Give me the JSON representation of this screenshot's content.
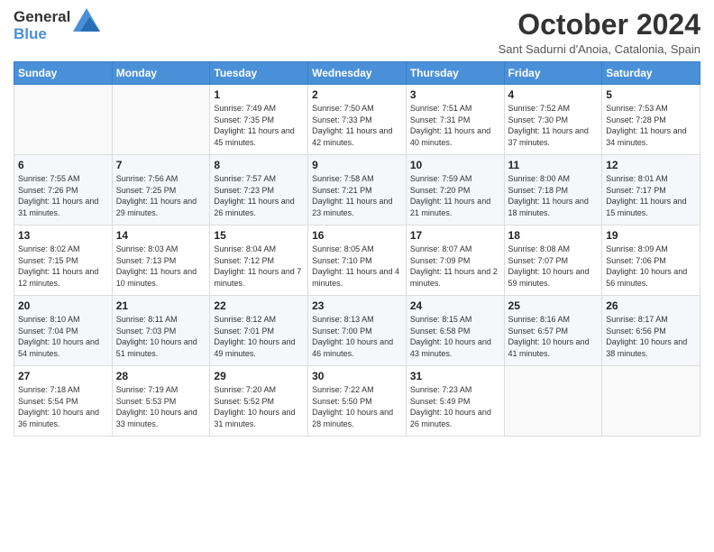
{
  "logo": {
    "line1": "General",
    "line2": "Blue"
  },
  "title": "October 2024",
  "subtitle": "Sant Sadurni d'Anoia, Catalonia, Spain",
  "days_of_week": [
    "Sunday",
    "Monday",
    "Tuesday",
    "Wednesday",
    "Thursday",
    "Friday",
    "Saturday"
  ],
  "weeks": [
    [
      {
        "day": "",
        "info": ""
      },
      {
        "day": "",
        "info": ""
      },
      {
        "day": "1",
        "info": "Sunrise: 7:49 AM\nSunset: 7:35 PM\nDaylight: 11 hours and 45 minutes."
      },
      {
        "day": "2",
        "info": "Sunrise: 7:50 AM\nSunset: 7:33 PM\nDaylight: 11 hours and 42 minutes."
      },
      {
        "day": "3",
        "info": "Sunrise: 7:51 AM\nSunset: 7:31 PM\nDaylight: 11 hours and 40 minutes."
      },
      {
        "day": "4",
        "info": "Sunrise: 7:52 AM\nSunset: 7:30 PM\nDaylight: 11 hours and 37 minutes."
      },
      {
        "day": "5",
        "info": "Sunrise: 7:53 AM\nSunset: 7:28 PM\nDaylight: 11 hours and 34 minutes."
      }
    ],
    [
      {
        "day": "6",
        "info": "Sunrise: 7:55 AM\nSunset: 7:26 PM\nDaylight: 11 hours and 31 minutes."
      },
      {
        "day": "7",
        "info": "Sunrise: 7:56 AM\nSunset: 7:25 PM\nDaylight: 11 hours and 29 minutes."
      },
      {
        "day": "8",
        "info": "Sunrise: 7:57 AM\nSunset: 7:23 PM\nDaylight: 11 hours and 26 minutes."
      },
      {
        "day": "9",
        "info": "Sunrise: 7:58 AM\nSunset: 7:21 PM\nDaylight: 11 hours and 23 minutes."
      },
      {
        "day": "10",
        "info": "Sunrise: 7:59 AM\nSunset: 7:20 PM\nDaylight: 11 hours and 21 minutes."
      },
      {
        "day": "11",
        "info": "Sunrise: 8:00 AM\nSunset: 7:18 PM\nDaylight: 11 hours and 18 minutes."
      },
      {
        "day": "12",
        "info": "Sunrise: 8:01 AM\nSunset: 7:17 PM\nDaylight: 11 hours and 15 minutes."
      }
    ],
    [
      {
        "day": "13",
        "info": "Sunrise: 8:02 AM\nSunset: 7:15 PM\nDaylight: 11 hours and 12 minutes."
      },
      {
        "day": "14",
        "info": "Sunrise: 8:03 AM\nSunset: 7:13 PM\nDaylight: 11 hours and 10 minutes."
      },
      {
        "day": "15",
        "info": "Sunrise: 8:04 AM\nSunset: 7:12 PM\nDaylight: 11 hours and 7 minutes."
      },
      {
        "day": "16",
        "info": "Sunrise: 8:05 AM\nSunset: 7:10 PM\nDaylight: 11 hours and 4 minutes."
      },
      {
        "day": "17",
        "info": "Sunrise: 8:07 AM\nSunset: 7:09 PM\nDaylight: 11 hours and 2 minutes."
      },
      {
        "day": "18",
        "info": "Sunrise: 8:08 AM\nSunset: 7:07 PM\nDaylight: 10 hours and 59 minutes."
      },
      {
        "day": "19",
        "info": "Sunrise: 8:09 AM\nSunset: 7:06 PM\nDaylight: 10 hours and 56 minutes."
      }
    ],
    [
      {
        "day": "20",
        "info": "Sunrise: 8:10 AM\nSunset: 7:04 PM\nDaylight: 10 hours and 54 minutes."
      },
      {
        "day": "21",
        "info": "Sunrise: 8:11 AM\nSunset: 7:03 PM\nDaylight: 10 hours and 51 minutes."
      },
      {
        "day": "22",
        "info": "Sunrise: 8:12 AM\nSunset: 7:01 PM\nDaylight: 10 hours and 49 minutes."
      },
      {
        "day": "23",
        "info": "Sunrise: 8:13 AM\nSunset: 7:00 PM\nDaylight: 10 hours and 46 minutes."
      },
      {
        "day": "24",
        "info": "Sunrise: 8:15 AM\nSunset: 6:58 PM\nDaylight: 10 hours and 43 minutes."
      },
      {
        "day": "25",
        "info": "Sunrise: 8:16 AM\nSunset: 6:57 PM\nDaylight: 10 hours and 41 minutes."
      },
      {
        "day": "26",
        "info": "Sunrise: 8:17 AM\nSunset: 6:56 PM\nDaylight: 10 hours and 38 minutes."
      }
    ],
    [
      {
        "day": "27",
        "info": "Sunrise: 7:18 AM\nSunset: 5:54 PM\nDaylight: 10 hours and 36 minutes."
      },
      {
        "day": "28",
        "info": "Sunrise: 7:19 AM\nSunset: 5:53 PM\nDaylight: 10 hours and 33 minutes."
      },
      {
        "day": "29",
        "info": "Sunrise: 7:20 AM\nSunset: 5:52 PM\nDaylight: 10 hours and 31 minutes."
      },
      {
        "day": "30",
        "info": "Sunrise: 7:22 AM\nSunset: 5:50 PM\nDaylight: 10 hours and 28 minutes."
      },
      {
        "day": "31",
        "info": "Sunrise: 7:23 AM\nSunset: 5:49 PM\nDaylight: 10 hours and 26 minutes."
      },
      {
        "day": "",
        "info": ""
      },
      {
        "day": "",
        "info": ""
      }
    ]
  ]
}
